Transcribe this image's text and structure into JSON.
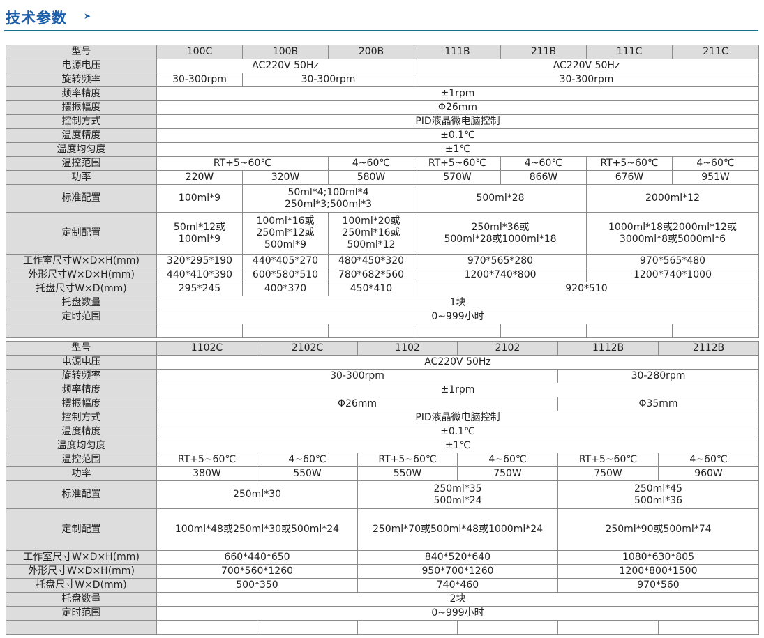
{
  "page": {
    "heading": "技术参数",
    "heading_arrow": "➤"
  },
  "table1": {
    "models": [
      "100C",
      "100B",
      "200B",
      "111B",
      "211B",
      "111C",
      "211C"
    ],
    "labels": {
      "model": "型号",
      "power_supply": "电源电压",
      "rotation_speed": "旋转频率",
      "speed_accuracy": "频率精度",
      "amplitude": "摆振幅度",
      "control_mode": "控制方式",
      "temp_accuracy": "温度精度",
      "temp_uniformity": "温度均匀度",
      "temp_range": "温控范围",
      "power": "功率",
      "standard_config": "标准配置",
      "custom_config": "定制配置",
      "chamber_size": "工作室尺寸W×D×H(mm)",
      "outer_size": "外形尺寸W×D×H(mm)",
      "tray_size": "托盘尺寸W×D(mm)",
      "tray_count": "托盘数量",
      "timer_range": "定时范围"
    },
    "power_supply": [
      "AC220V 50Hz",
      "AC220V 50Hz"
    ],
    "rotation_speed": [
      "30-300rpm",
      "30-300rpm",
      "30-300rpm"
    ],
    "speed_accuracy": "±1rpm",
    "amplitude": "Φ26mm",
    "control_mode": "PID液晶微电脑控制",
    "temp_accuracy": "±0.1℃",
    "temp_uniformity": "±1℃",
    "temp_range": [
      "RT+5~60℃",
      "4~60℃",
      "RT+5~60℃",
      "4~60℃",
      "RT+5~60℃",
      "4~60℃"
    ],
    "power": [
      "220W",
      "320W",
      "580W",
      "570W",
      "866W",
      "676W",
      "951W"
    ],
    "standard_config": [
      "100ml*9",
      "50ml*4;100ml*4\n250ml*3;500ml*3",
      "500ml*28",
      "2000ml*12"
    ],
    "custom_config": [
      "50ml*12或\n100ml*9",
      "100ml*16或\n250ml*12或\n500ml*9",
      "100ml*20或\n250ml*16或\n500ml*12",
      "250ml*36或\n500ml*28或1000ml*18",
      "1000ml*18或2000ml*12或\n3000ml*8或5000ml*6"
    ],
    "chamber_size": [
      "320*295*190",
      "440*405*270",
      "480*450*320",
      "970*565*280",
      "970*565*480"
    ],
    "outer_size": [
      "440*410*390",
      "600*580*510",
      "780*682*560",
      "1200*740*800",
      "1200*740*1000"
    ],
    "tray_size": [
      "295*245",
      "400*370",
      "450*410",
      "920*510"
    ],
    "tray_count": "1块",
    "timer_range": "0~999小时"
  },
  "table2": {
    "models": [
      "1102C",
      "2102C",
      "1102",
      "2102",
      "1112B",
      "2112B"
    ],
    "labels": {
      "model": "型号",
      "power_supply": "电源电压",
      "rotation_speed": "旋转频率",
      "speed_accuracy": "频率精度",
      "amplitude": "摆振幅度",
      "control_mode": "控制方式",
      "temp_accuracy": "温度精度",
      "temp_uniformity": "温度均匀度",
      "temp_range": "温控范围",
      "power": "功率",
      "standard_config": "标准配置",
      "custom_config": "定制配置",
      "chamber_size": "工作室尺寸W×D×H(mm)",
      "outer_size": "外形尺寸W×D×H(mm)",
      "tray_size": "托盘尺寸W×D(mm)",
      "tray_count": "托盘数量",
      "timer_range": "定时范围"
    },
    "power_supply": "AC220V 50Hz",
    "rotation_speed": [
      "30-300rpm",
      "30-280rpm"
    ],
    "speed_accuracy": "±1rpm",
    "amplitude": [
      "Φ26mm",
      "Φ35mm"
    ],
    "control_mode": "PID液晶微电脑控制",
    "temp_accuracy": "±0.1℃",
    "temp_uniformity": "±1℃",
    "temp_range": [
      "RT+5~60℃",
      "4~60℃",
      "RT+5~60℃",
      "4~60℃",
      "RT+5~60℃",
      "4~60℃"
    ],
    "power": [
      "380W",
      "550W",
      "550W",
      "750W",
      "750W",
      "960W"
    ],
    "standard_config": [
      "250ml*30",
      "250ml*35\n500ml*24",
      "250ml*45\n500ml*36"
    ],
    "custom_config": [
      "100ml*48或250ml*30或500ml*24",
      "250ml*70或500ml*48或1000ml*24",
      "250ml*90或500ml*74"
    ],
    "chamber_size": [
      "660*440*650",
      "840*520*640",
      "1080*630*805"
    ],
    "outer_size": [
      "700*560*1260",
      "950*700*1260",
      "1200*800*1500"
    ],
    "tray_size": [
      "500*350",
      "740*460",
      "970*560"
    ],
    "tray_count": "2块",
    "timer_range": "0~999小时"
  }
}
